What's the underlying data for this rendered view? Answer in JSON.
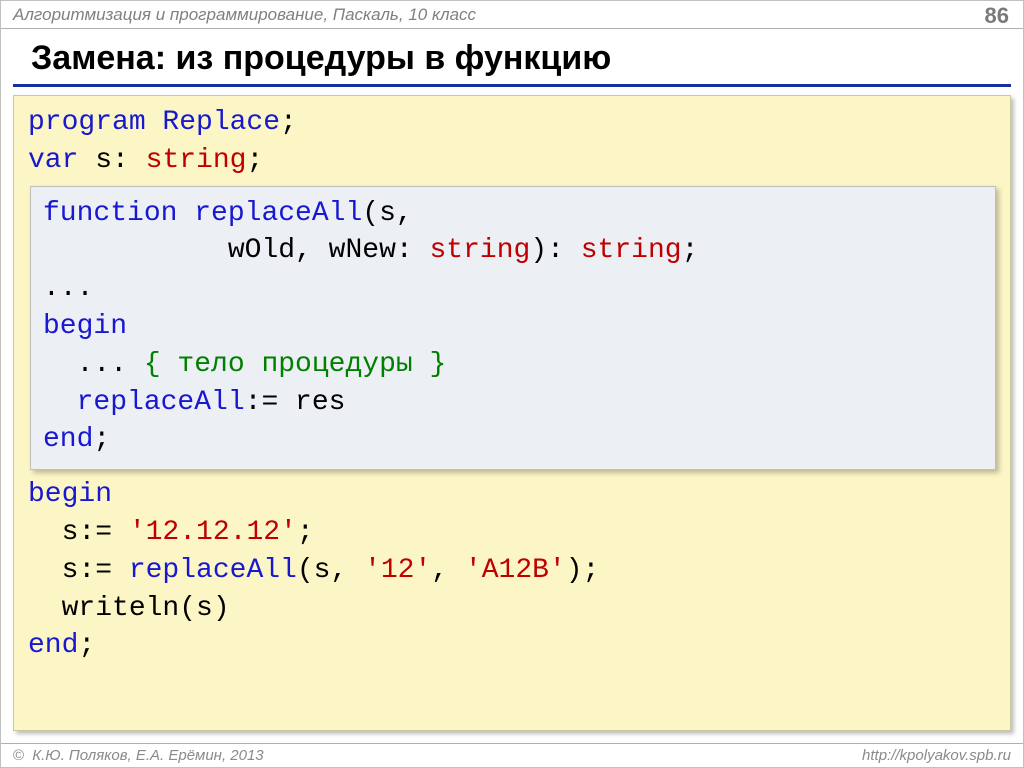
{
  "header": {
    "course": "Алгоритмизация и программирование, Паскаль, 10 класс",
    "page": "86"
  },
  "title": "Замена: из процедуры в функцию",
  "code": {
    "outer": {
      "l1_kw": "program ",
      "l1_name": "Replace",
      "l1_end": ";",
      "l2_kw": "var ",
      "l2_var": "s: ",
      "l2_type": "string",
      "l2_end": ";",
      "l8_kw": "begin",
      "l9_txt": "  s:= ",
      "l9_str": "'12.12.12'",
      "l9_end": ";",
      "l10_txt": "  s:= ",
      "l10_name": "replaceAll",
      "l10_mid": "(s, ",
      "l10_str1": "'12'",
      "l10_comma": ", ",
      "l10_str2": "'A12B'",
      "l10_end": ");",
      "l11_txt": "  writeln(s)",
      "l12_kw": "end",
      "l12_end": ";"
    },
    "inner": {
      "l1_kw": "function ",
      "l1_name": "replaceAll",
      "l1_open": "(s,",
      "l2_pad": "           ",
      "l2_args": "wOld, wNew: ",
      "l2_type1": "string",
      "l2_mid": "): ",
      "l2_type2": "string",
      "l2_end": ";",
      "l3_txt": "...",
      "l4_kw": "begin",
      "l5_txt": "  ... ",
      "l5_cmt": "{ тело процедуры }",
      "l6_pad": "  ",
      "l6_name": "replaceAll",
      "l6_rest": ":= res",
      "l7_kw": "end",
      "l7_end": ";"
    }
  },
  "footer": {
    "copyright_symbol": "©",
    "authors": "К.Ю. Поляков, Е.А. Ерёмин, 2013",
    "url": "http://kpolyakov.spb.ru"
  }
}
